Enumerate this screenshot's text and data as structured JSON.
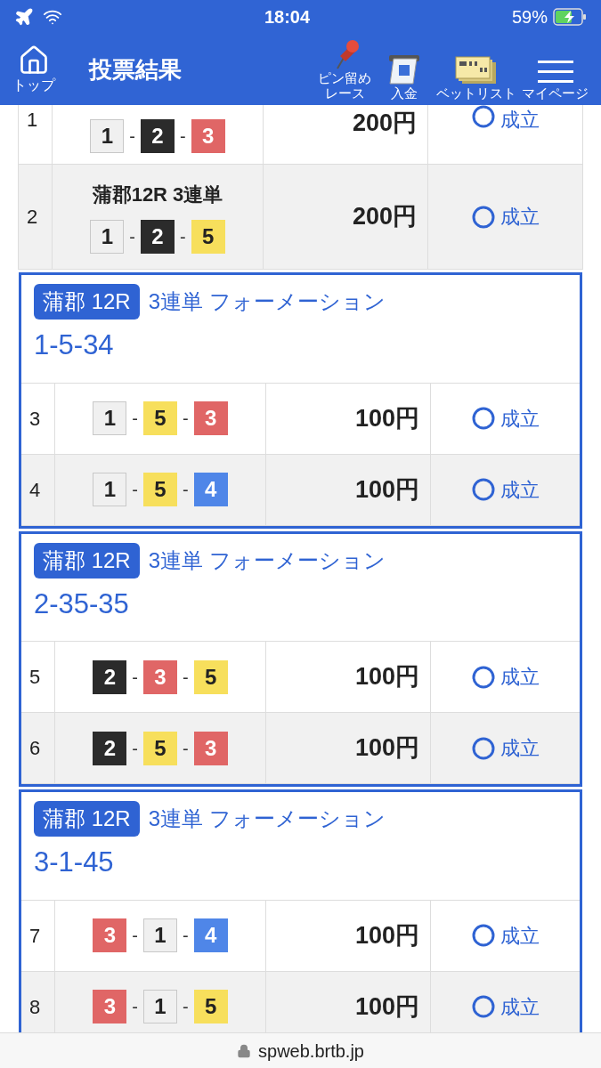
{
  "status_bar": {
    "time": "18:04",
    "battery": "59%"
  },
  "header": {
    "home_label": "トップ",
    "title": "投票結果",
    "actions": [
      {
        "kind": "pin",
        "label": "ピン留めレース"
      },
      {
        "kind": "deposit",
        "label": "入金"
      },
      {
        "kind": "betlist",
        "label": "ベットリスト"
      },
      {
        "kind": "menu",
        "label": "マイページ"
      }
    ]
  },
  "loose_rows": [
    {
      "index": "1",
      "boats": [
        {
          "number": "1",
          "color": "#f0f0f0"
        },
        {
          "sep": "-",
          "number": "2",
          "color": "#2b2b2b"
        },
        {
          "sep": "-",
          "number": "3",
          "color": "#e06666"
        }
      ],
      "amount": "200円",
      "status": "成立"
    },
    {
      "index": "2",
      "race": "蒲郡12R 3連単",
      "boats": [
        {
          "number": "1",
          "color": "#f0f0f0"
        },
        {
          "sep": "-",
          "number": "2",
          "color": "#2b2b2b"
        },
        {
          "sep": "-",
          "number": "5",
          "color": "#f7df5c"
        }
      ],
      "amount": "200円",
      "status": "成立"
    }
  ],
  "groups": [
    {
      "venue": "蒲郡 12R",
      "bet_type": "3連単 フォーメーション",
      "combination": "1-5-34",
      "rows": [
        {
          "index": "3",
          "boats": [
            {
              "number": "1",
              "color": "#f0f0f0"
            },
            {
              "sep": "-",
              "number": "5",
              "color": "#f7df5c"
            },
            {
              "sep": "-",
              "number": "3",
              "color": "#e06666"
            }
          ],
          "amount": "100円",
          "status": "成立"
        },
        {
          "index": "4",
          "boats": [
            {
              "number": "1",
              "color": "#f0f0f0"
            },
            {
              "sep": "-",
              "number": "5",
              "color": "#f7df5c"
            },
            {
              "sep": "-",
              "number": "4",
              "color": "#4f86e8"
            }
          ],
          "amount": "100円",
          "status": "成立"
        }
      ]
    },
    {
      "venue": "蒲郡 12R",
      "bet_type": "3連単 フォーメーション",
      "combination": "2-35-35",
      "rows": [
        {
          "index": "5",
          "boats": [
            {
              "number": "2",
              "color": "#2b2b2b"
            },
            {
              "sep": "-",
              "number": "3",
              "color": "#e06666"
            },
            {
              "sep": "-",
              "number": "5",
              "color": "#f7df5c"
            }
          ],
          "amount": "100円",
          "status": "成立"
        },
        {
          "index": "6",
          "boats": [
            {
              "number": "2",
              "color": "#2b2b2b"
            },
            {
              "sep": "-",
              "number": "5",
              "color": "#f7df5c"
            },
            {
              "sep": "-",
              "number": "3",
              "color": "#e06666"
            }
          ],
          "amount": "100円",
          "status": "成立"
        }
      ]
    },
    {
      "venue": "蒲郡 12R",
      "bet_type": "3連単 フォーメーション",
      "combination": "3-1-45",
      "rows": [
        {
          "index": "7",
          "boats": [
            {
              "number": "3",
              "color": "#e06666"
            },
            {
              "sep": "-",
              "number": "1",
              "color": "#f0f0f0"
            },
            {
              "sep": "-",
              "number": "4",
              "color": "#4f86e8"
            }
          ],
          "amount": "100円",
          "status": "成立"
        },
        {
          "index": "8",
          "boats": [
            {
              "number": "3",
              "color": "#e06666"
            },
            {
              "sep": "-",
              "number": "1",
              "color": "#f0f0f0"
            },
            {
              "sep": "-",
              "number": "5",
              "color": "#f7df5c"
            }
          ],
          "amount": "100円",
          "status": "成立"
        }
      ]
    }
  ],
  "url_bar": {
    "url": "spweb.brtb.jp"
  }
}
